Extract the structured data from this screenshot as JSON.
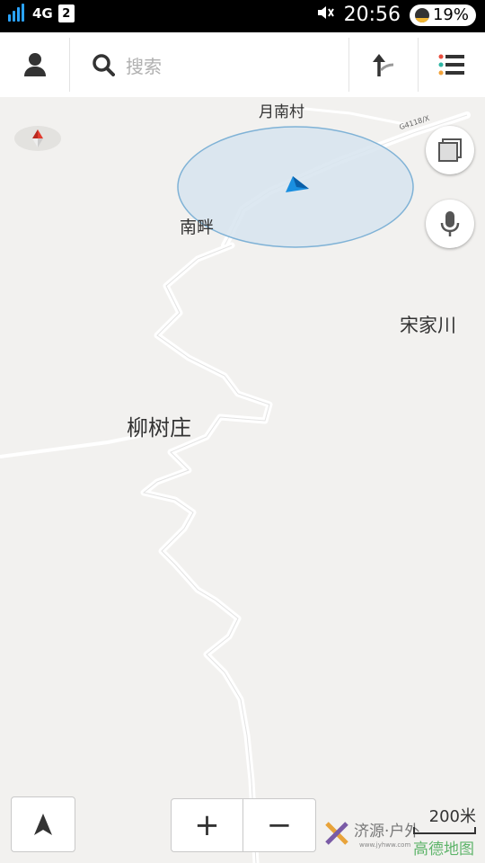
{
  "status_bar": {
    "network": "4G",
    "sim_slot": "2",
    "time": "20:56",
    "battery": "19%"
  },
  "toolbar": {
    "search_placeholder": "搜索"
  },
  "map": {
    "places": {
      "yuenan": "月南村",
      "nanpan": "南畔",
      "songjiachuan": "宋家川",
      "liushuzhuang": "柳树庄"
    },
    "road_label": "G4118/X",
    "scale": "200米"
  },
  "zoom": {
    "in_label": "+",
    "out_label": "−"
  },
  "watermark": {
    "brand": "济源·户外",
    "url": "www.jyhww.com",
    "logo": "高德地图"
  },
  "icons": [
    "signal-icon",
    "mute-icon",
    "user-icon",
    "search-icon",
    "route-icon",
    "menu-icon",
    "compass-icon",
    "layers-icon",
    "microphone-icon",
    "locate-arrow-icon",
    "location-arrow-icon"
  ],
  "colors": {
    "accent_blue": "#1a8fe0",
    "accuracy_circle": "#d7e4ee",
    "road": "#ffffff",
    "menu_dots": [
      "#e84c3d",
      "#2db5a3",
      "#f2a33a"
    ]
  }
}
